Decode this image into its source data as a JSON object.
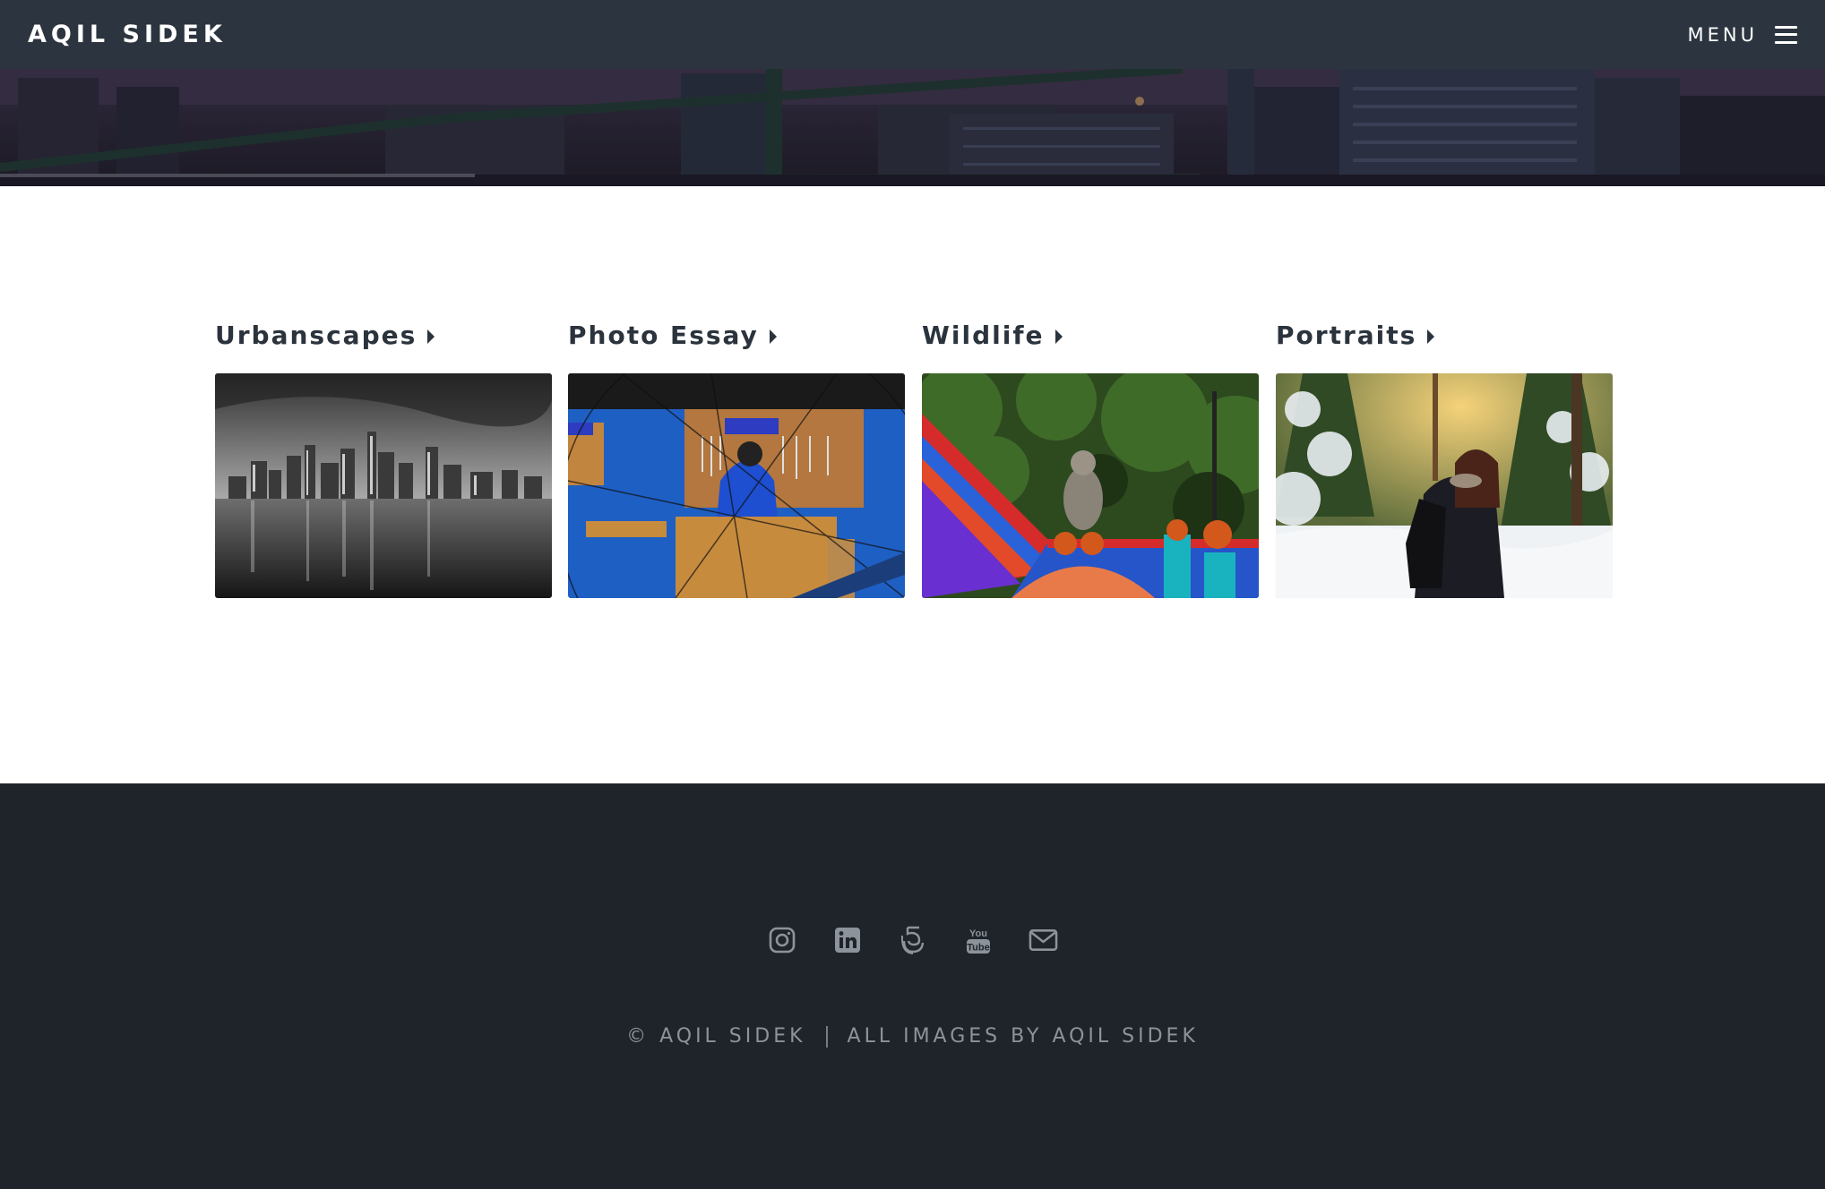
{
  "header": {
    "brand": "AQIL SIDEK",
    "menu_label": "MENU",
    "background": "#2c353f"
  },
  "hero": {
    "description_icon": "city-skyline-bridge-photo"
  },
  "galleries": [
    {
      "title": "Urbanscapes",
      "image_icon": "nyc-skyline-bw-photo"
    },
    {
      "title": "Photo Essay",
      "image_icon": "bike-workshop-photo"
    },
    {
      "title": "Wildlife",
      "image_icon": "monkey-on-stairs-photo"
    },
    {
      "title": "Portraits",
      "image_icon": "snow-forest-portrait-photo"
    }
  ],
  "footer": {
    "background": "#1f242b",
    "social_icons": [
      "instagram-icon",
      "linkedin-icon",
      "500px-icon",
      "youtube-icon",
      "email-icon"
    ],
    "copyright": "© AQIL SIDEK",
    "credit": "ALL IMAGES BY AQIL SIDEK"
  },
  "colors": {
    "text_dark": "#2b333d",
    "footer_text": "#8d939a"
  }
}
